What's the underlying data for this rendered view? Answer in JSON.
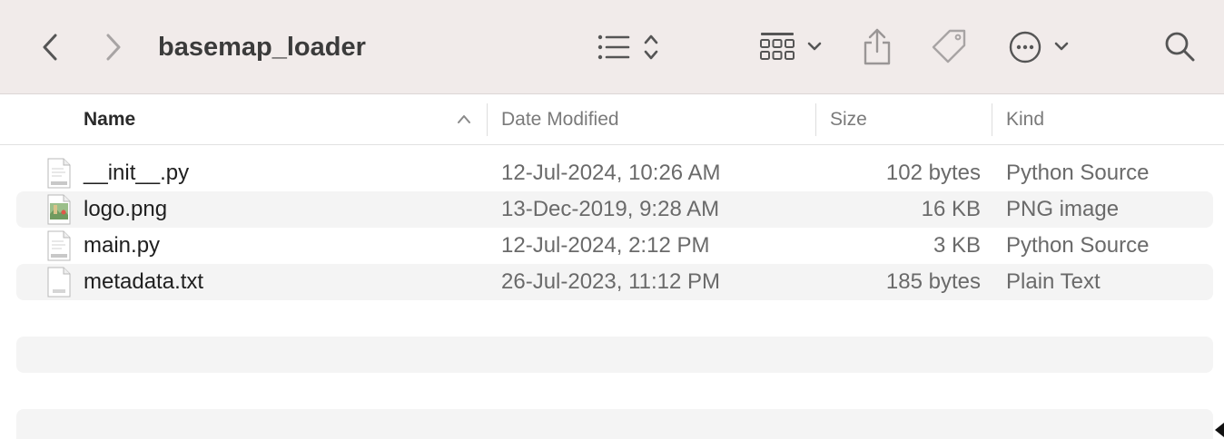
{
  "window": {
    "title": "basemap_loader"
  },
  "toolbar": {
    "back_icon": "chevron-left-icon",
    "forward_icon": "chevron-right-icon",
    "view_icon": "list-view-icon",
    "group_icon": "grid-group-icon",
    "share_icon": "share-icon",
    "tag_icon": "tag-icon",
    "more_icon": "ellipsis-circle-icon",
    "search_icon": "search-icon"
  },
  "columns": {
    "name": "Name",
    "date": "Date Modified",
    "size": "Size",
    "kind": "Kind"
  },
  "files": [
    {
      "name": "__init__.py",
      "date": "12-Jul-2024, 10:26 AM",
      "size": "102 bytes",
      "kind": "Python Source",
      "icon": "python-file-icon"
    },
    {
      "name": "logo.png",
      "date": "13-Dec-2019, 9:28 AM",
      "size": "16 KB",
      "kind": "PNG image",
      "icon": "image-file-icon"
    },
    {
      "name": "main.py",
      "date": "12-Jul-2024, 2:12 PM",
      "size": "3 KB",
      "kind": "Python Source",
      "icon": "python-file-icon"
    },
    {
      "name": "metadata.txt",
      "date": "26-Jul-2023, 11:12 PM",
      "size": "185 bytes",
      "kind": "Plain Text",
      "icon": "text-file-icon"
    }
  ],
  "colors": {
    "toolbar_bg": "#f1ebea",
    "row_alt": "#f4f4f4"
  }
}
